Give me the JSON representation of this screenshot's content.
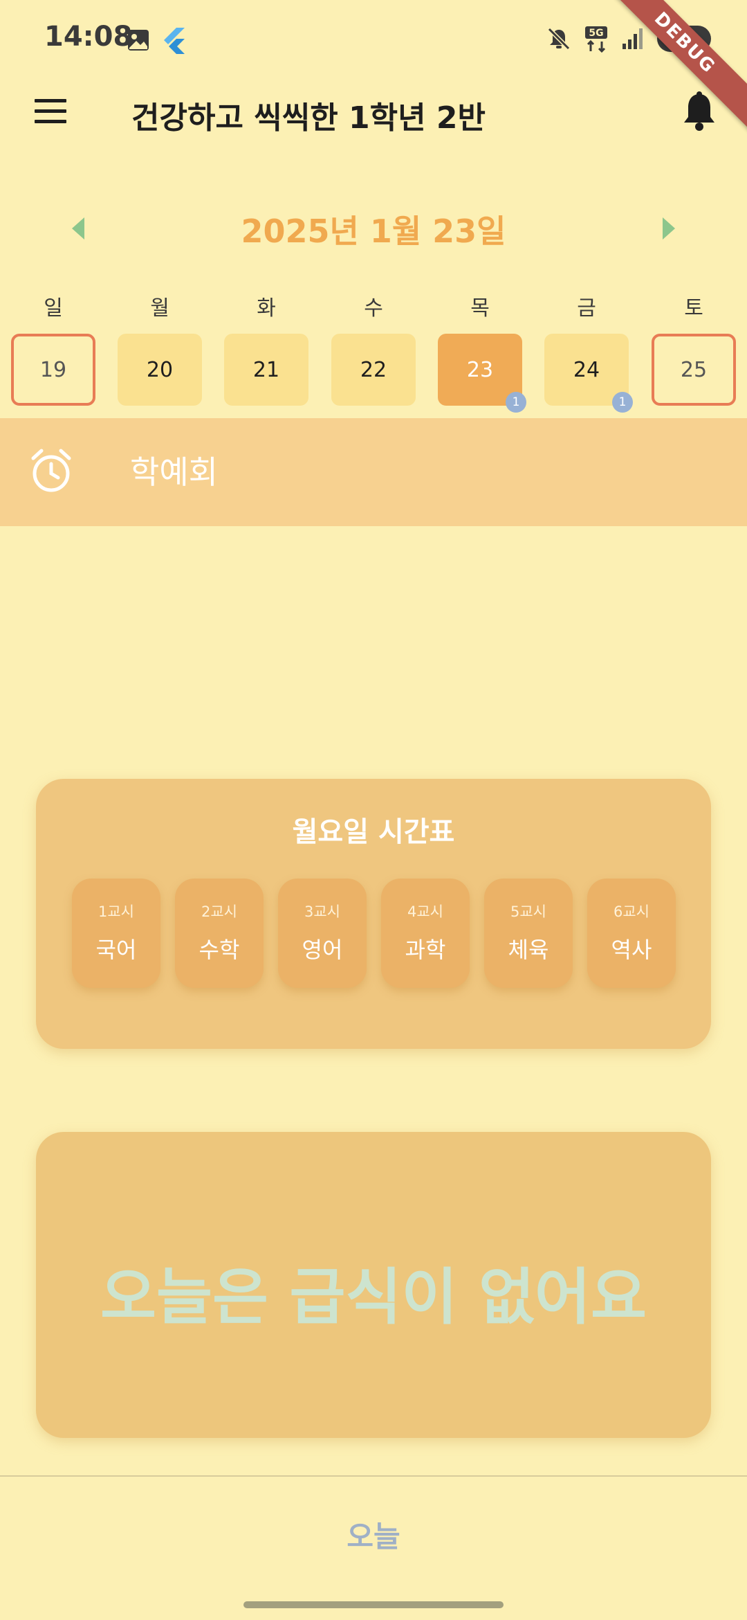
{
  "status_bar": {
    "time": "14:08",
    "battery": "38",
    "network": "5G"
  },
  "debug_banner": "DEBUG",
  "app_bar": {
    "title": "건강하고 씩씩한 1학년 2반"
  },
  "date_nav": {
    "current_date": "2025년 1월 23일"
  },
  "week": {
    "weekdays": [
      "일",
      "월",
      "화",
      "수",
      "목",
      "금",
      "토"
    ],
    "days": [
      {
        "num": "19",
        "weekend": true
      },
      {
        "num": "20"
      },
      {
        "num": "21"
      },
      {
        "num": "22"
      },
      {
        "num": "23",
        "selected": true,
        "badge": "1"
      },
      {
        "num": "24",
        "badge": "1"
      },
      {
        "num": "25",
        "weekend": true
      }
    ]
  },
  "event_banner": {
    "text": "학예회"
  },
  "timetable": {
    "title": "월요일 시간표",
    "periods": [
      {
        "period": "1교시",
        "subject": "국어"
      },
      {
        "period": "2교시",
        "subject": "수학"
      },
      {
        "period": "3교시",
        "subject": "영어"
      },
      {
        "period": "4교시",
        "subject": "과학"
      },
      {
        "period": "5교시",
        "subject": "체육"
      },
      {
        "period": "6교시",
        "subject": "역사"
      }
    ]
  },
  "meal": {
    "text": "오늘은 급식이 없어요"
  },
  "bottom": {
    "today_label": "오늘"
  },
  "colors": {
    "background": "#fcf0b4",
    "accent": "#f0a94f",
    "selected_day": "#f0ab56",
    "weekend_border": "#e87c55",
    "arrow": "#8cc68c",
    "badge": "#97b1d5"
  }
}
